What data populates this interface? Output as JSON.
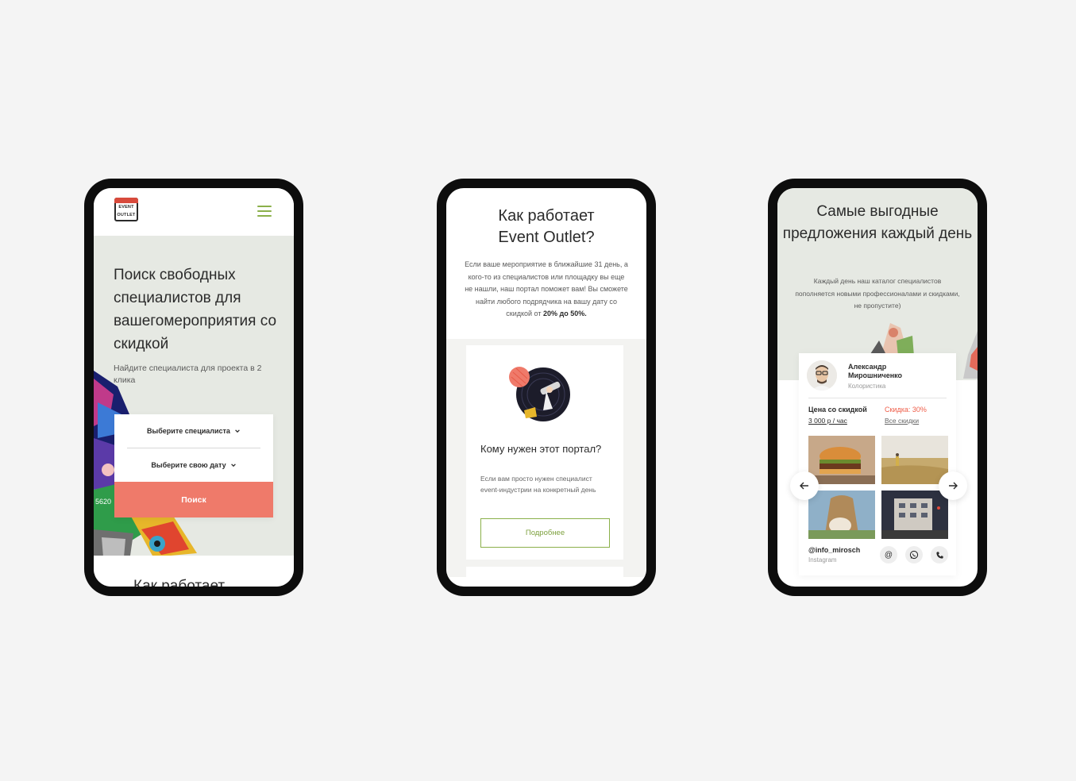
{
  "phone1": {
    "logo_line1": "EVENT",
    "logo_line2": "OUTLET",
    "hero_title": "Поиск свободных специалистов для вашегомероприятия со скидкой",
    "hero_subtitle": "Найдите специалиста для проекта в 2 клика",
    "select_specialist": "Выберите специалиста",
    "select_date": "Выберите свою дату",
    "search_button": "Поиск",
    "next_section_title": "Как работает",
    "art_number": "5620"
  },
  "phone2": {
    "title_line1": "Как работает",
    "title_line2": "Event Outlet?",
    "description": "Если ваше мероприятие в ближайшие 31 день, а кого-то из специалистов или площадку вы еще не нашли, наш портал поможет вам! Вы сможете найти любого подрядчика на вашу дату со скидкой от",
    "description_bold": "20% до 50%.",
    "card_title": "Кому нужен этот портал?",
    "card_text": "Если вам просто нужен специалист event-индустрии на конкретный день",
    "card_button": "Подробнее"
  },
  "phone3": {
    "title": "Самые выгодные предложения каждый день",
    "description": "Каждый день наш каталог специалистов пополняется новыми профессионалами и скидками, не пропустите)",
    "person_name_line1": "Александр",
    "person_name_line2": "Мирошниченко",
    "person_role": "Колористика",
    "price_label": "Цена со скидкой",
    "price_value": "3 000 р / час",
    "discount_label": "Скидка: 30%",
    "discount_link": "Все скидки",
    "handle": "@info_mirosch",
    "handle_source": "Instagram",
    "icon_at": "@"
  },
  "colors": {
    "background": "#f4f4f4",
    "phone_frame": "#0d0d0d",
    "hero_bg": "#e6e9e3",
    "accent_green": "#8bb04a",
    "accent_coral": "#ef7a6a",
    "discount_red": "#ef5d48"
  },
  "icons": [
    "calendar-logo-icon",
    "hamburger-menu-icon",
    "chevron-down-icon",
    "arrow-left-icon",
    "arrow-right-icon",
    "at-icon",
    "whatsapp-icon",
    "phone-icon"
  ]
}
